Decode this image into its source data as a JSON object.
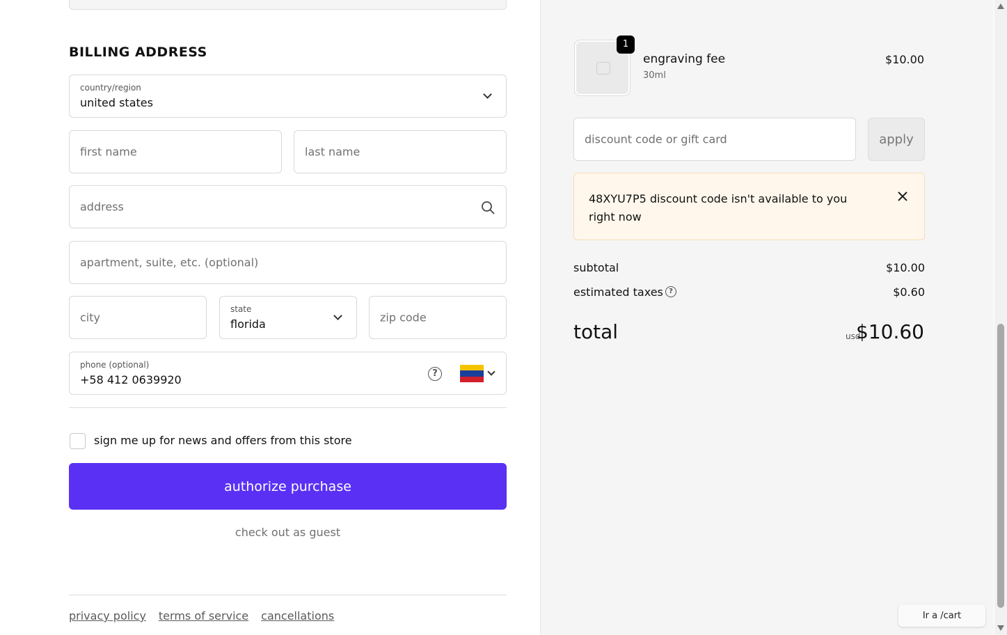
{
  "billing": {
    "heading": "BILLING ADDRESS",
    "country": {
      "label": "country/region",
      "value": "united states"
    },
    "first_name": {
      "placeholder": "first name"
    },
    "last_name": {
      "placeholder": "last name"
    },
    "address": {
      "placeholder": "address"
    },
    "apartment": {
      "placeholder": "apartment, suite, etc. (optional)"
    },
    "city": {
      "placeholder": "city"
    },
    "state": {
      "label": "state",
      "value": "florida"
    },
    "zip": {
      "placeholder": "zip code"
    },
    "phone": {
      "label": "phone (optional)",
      "value": "+58 412 0639920",
      "help_icon": "?"
    },
    "newsletter_label": "sign me up for news and offers from this store",
    "authorize_label": "authorize purchase",
    "guest_label": "check out as guest"
  },
  "footer": {
    "links": [
      "privacy policy",
      "terms of service",
      "cancellations"
    ]
  },
  "order": {
    "item": {
      "name": "engraving fee",
      "variant": "30ml",
      "price": "$10.00",
      "quantity": "1"
    },
    "discount_placeholder": "discount code or gift card",
    "apply_label": "apply",
    "alert_text": "48XYU7P5 discount code isn't available to you right now",
    "subtotal_label": "subtotal",
    "subtotal_value": "$10.00",
    "taxes_label": "estimated taxes",
    "taxes_help_icon": "?",
    "taxes_value": "$0.60",
    "total_label": "total",
    "total_currency": "usd",
    "total_value": "$10.60"
  },
  "cart_chip": "Ir a /cart",
  "colors": {
    "accent": "#5a31f4",
    "alert_bg": "#fff7ec"
  },
  "icons": {
    "country": "chevron-down-icon",
    "address": "search-icon",
    "phone_help": "help-circle-icon",
    "phone_flag": "venezuela-flag-icon",
    "close": "close-icon",
    "product": "image-placeholder-icon"
  }
}
